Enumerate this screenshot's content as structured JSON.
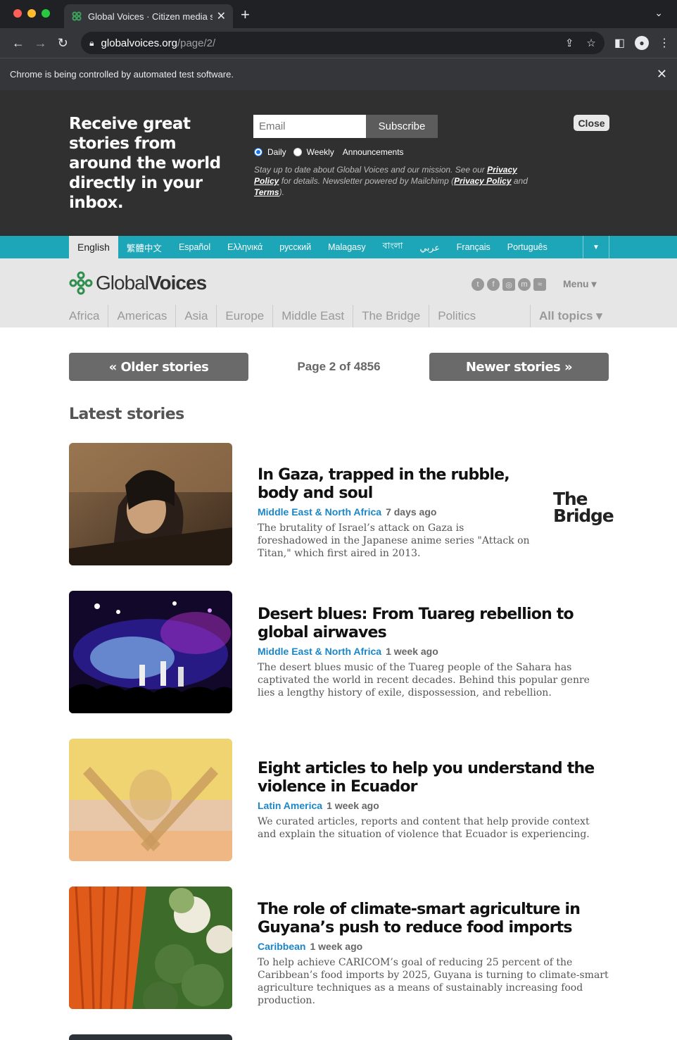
{
  "browser": {
    "tab_title": "Global Voices · Citizen media s",
    "url_host": "globalvoices.org",
    "url_path": "/page/2/",
    "infobar_message": "Chrome is being controlled by automated test software."
  },
  "newsletter": {
    "heading": "Receive great stories from around the world directly in your inbox.",
    "email_placeholder": "Email",
    "subscribe_label": "Subscribe",
    "close_label": "Close",
    "opt_daily": "Daily",
    "opt_weekly": "Weekly",
    "opt_announcements": "Announcements",
    "fine_1": "Stay up to date about Global Voices and our mission. See our ",
    "privacy_policy": "Privacy Policy",
    "fine_2": " for details. Newsletter powered by Mailchimp (",
    "mailchimp_privacy": "Privacy Policy",
    "fine_and": " and ",
    "terms": "Terms",
    "fine_3": ")."
  },
  "languages": [
    "English",
    "繁體中文",
    "Español",
    "Ελληνικά",
    "русский",
    "Malagasy",
    "বাংলা",
    "عربي",
    "Français",
    "Português"
  ],
  "site": {
    "logo_light": "Global",
    "logo_bold": "Voices",
    "menu_label": "Menu ▾",
    "regions": [
      "Africa",
      "Americas",
      "Asia",
      "Europe",
      "Middle East",
      "The Bridge",
      "Politics"
    ],
    "all_topics": "All topics ▾"
  },
  "pager": {
    "older": "« Older stories",
    "newer": "Newer stories »",
    "page_info": "Page 2 of 4856"
  },
  "latest_heading": "Latest stories",
  "stories": [
    {
      "title": "In Gaza, trapped in the rubble, body and soul",
      "category": "Middle East & North Africa",
      "time": "7 days ago",
      "excerpt": "The brutality of Israel’s attack on Gaza is foreshadowed in the Japanese anime series \"Attack on Titan,\" which first aired in 2013.",
      "badge": "The Bridge"
    },
    {
      "title": "Desert blues: From Tuareg rebellion to global airwaves",
      "category": "Middle East & North Africa",
      "time": "1 week ago",
      "excerpt": "The desert blues music of the Tuareg people of the Sahara has captivated the world in recent decades. Behind this popular genre lies a lengthy history of exile, dispossession, and rebellion."
    },
    {
      "title": "Eight articles to help you understand the violence in Ecuador",
      "category": "Latin America",
      "time": "1 week ago",
      "excerpt": "We curated articles, reports and content that help provide context and explain the situation of violence that Ecuador is experiencing."
    },
    {
      "title": "The role of climate-smart agriculture in Guyana’s push to reduce food imports",
      "category": "Caribbean",
      "time": "1 week ago",
      "excerpt": "To help achieve CARICOM’s goal of reducing 25 percent of the Caribbean’s food imports by 2025, Guyana is turning to climate-smart agriculture techniques as a means of sustainably increasing food production."
    }
  ]
}
